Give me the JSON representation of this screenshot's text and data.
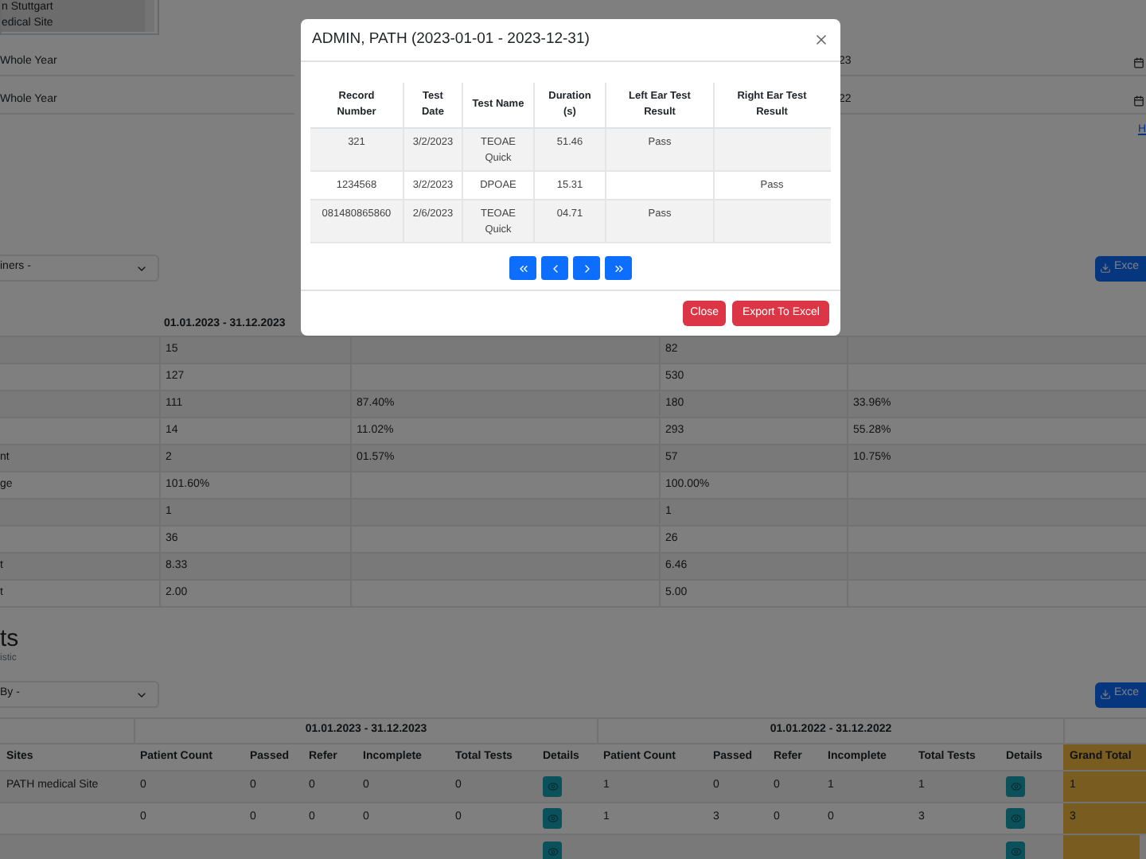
{
  "filters": {
    "site_list": [
      {
        "label": "n Stuttgart"
      },
      {
        "label": "edical Site"
      }
    ],
    "period_rows": [
      {
        "label": "Whole Year",
        "date": "23"
      },
      {
        "label": "Whole Year",
        "date": "22"
      }
    ],
    "link": "H"
  },
  "summary": {
    "group_select": "iners -",
    "excel_button": "Exce",
    "period_header": "01.01.2023 - 31.12.2023",
    "rows": [
      {
        "current": {
          "count": "15"
        },
        "previous": {
          "count": "82"
        }
      },
      {
        "current": {
          "count": "127"
        },
        "previous": {
          "count": "530"
        }
      },
      {
        "current": {
          "count": "111",
          "percent": "87.40%"
        },
        "previous": {
          "count": "180",
          "percent": "33.96%"
        }
      },
      {
        "current": {
          "count": "14",
          "percent": "11.02%"
        },
        "previous": {
          "count": "293",
          "percent": "55.28%"
        }
      },
      {
        "label": "nt",
        "current": {
          "count": "2",
          "percent": "01.57%"
        },
        "previous": {
          "count": "57",
          "percent": "10.75%"
        }
      },
      {
        "label": "ge",
        "current": {
          "count": "101.60%"
        },
        "previous": {
          "count": "100.00%"
        }
      },
      {
        "current": {
          "count": "1"
        },
        "previous": {
          "count": "1"
        }
      },
      {
        "current": {
          "count": "36"
        },
        "previous": {
          "count": "26"
        }
      },
      {
        "label": "t",
        "current": {
          "count": "8.33"
        },
        "previous": {
          "count": "6.46"
        }
      },
      {
        "label": "t",
        "current": {
          "count": "2.00"
        },
        "previous": {
          "count": "5.00"
        }
      }
    ]
  },
  "results": {
    "title": "ts",
    "subtitle": "istic",
    "group_select": "By -",
    "excel_button": "Exce",
    "periods": [
      "01.01.2023 - 31.12.2023",
      "01.01.2022 - 31.12.2022"
    ],
    "columns": [
      {
        "label": "Sites",
        "kind": "site"
      },
      {
        "label": "Patient Count",
        "kind": "metric"
      },
      {
        "label": "Passed",
        "kind": "metric"
      },
      {
        "label": "Refer",
        "kind": "metric"
      },
      {
        "label": "Incomplete",
        "kind": "metric"
      },
      {
        "label": "Total Tests",
        "kind": "metric"
      },
      {
        "label": "Details",
        "kind": "details"
      },
      {
        "label": "Patient Count",
        "kind": "metric"
      },
      {
        "label": "Passed",
        "kind": "metric"
      },
      {
        "label": "Refer",
        "kind": "metric"
      },
      {
        "label": "Incomplete",
        "kind": "metric"
      },
      {
        "label": "Total Tests",
        "kind": "metric"
      },
      {
        "label": "Details",
        "kind": "details"
      },
      {
        "label": "Grand Total",
        "kind": "total"
      }
    ],
    "rows": [
      {
        "site": "PATH medical Site",
        "periods": [
          [
            "0",
            "0",
            "0",
            "0",
            "0"
          ],
          [
            "1",
            "0",
            "0",
            "1",
            "1"
          ]
        ],
        "grand_total": "1"
      },
      {
        "periods": [
          [
            "0",
            "0",
            "0",
            "0",
            "0"
          ],
          [
            "1",
            "3",
            "0",
            "0",
            "3"
          ]
        ],
        "grand_total": "3"
      }
    ]
  },
  "modal": {
    "title": "ADMIN, PATH (2023-01-01 - 2023-12-31)",
    "columns": [
      "Record Number",
      "Test Date",
      "Test Name",
      "Duration (s)",
      "Left Ear Test Result",
      "Right Ear Test Result"
    ],
    "rows": [
      {
        "record": "321",
        "date": "3/2/2023",
        "test": "TEOAE Quick",
        "duration": "51.46",
        "left": "Pass"
      },
      {
        "record": "1234568",
        "date": "3/2/2023",
        "test": "DPOAE",
        "duration": "15.31",
        "right": "Pass"
      },
      {
        "record": "081480865860",
        "date": "2/6/2023",
        "test": "TEOAE Quick",
        "duration": "04.71",
        "left": "Pass"
      }
    ],
    "buttons": [
      {
        "label": "Close",
        "kind": "close"
      },
      {
        "label": "Export To Excel",
        "kind": "export"
      }
    ]
  }
}
